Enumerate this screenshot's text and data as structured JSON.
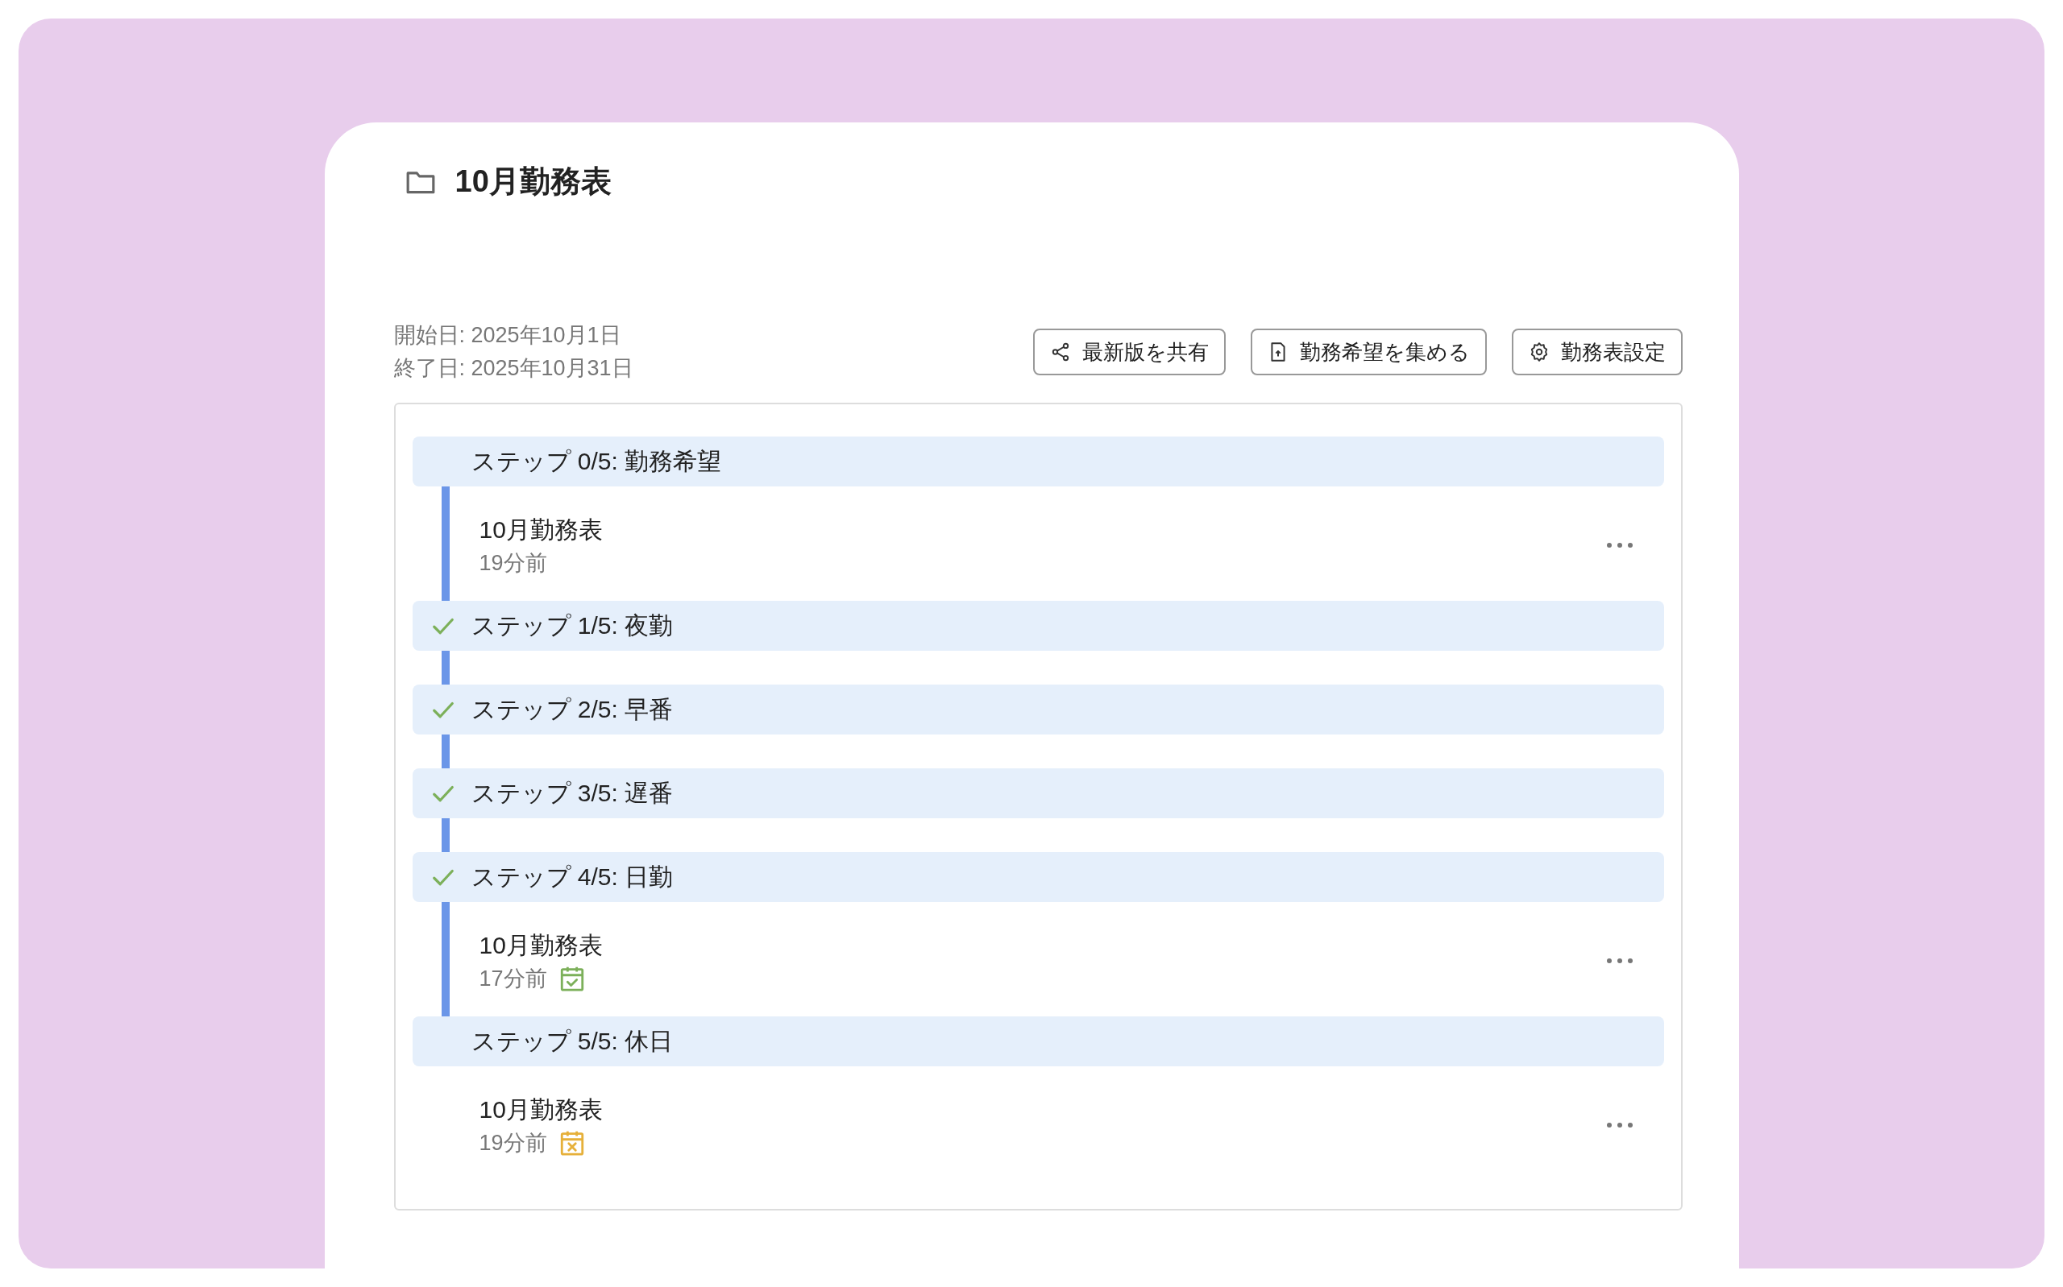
{
  "title": "10月勤務表",
  "start_date": "開始日: 2025年10月1日",
  "end_date": "終了日: 2025年10月31日",
  "buttons": [
    {
      "kind": "share",
      "label": "最新版を共有"
    },
    {
      "kind": "collect",
      "label": "勤務希望を集める"
    },
    {
      "kind": "settings",
      "label": "勤務表設定"
    }
  ],
  "steps": [
    {
      "label": "ステップ 0/5: 勤務希望",
      "done": false,
      "rail": true,
      "items": [
        {
          "title": "10月勤務表",
          "time": "19分前"
        }
      ]
    },
    {
      "label": "ステップ 1/5: 夜勤",
      "done": true,
      "rail": true
    },
    {
      "label": "ステップ 2/5: 早番",
      "done": true,
      "rail": true
    },
    {
      "label": "ステップ 3/5: 遅番",
      "done": true,
      "rail": true
    },
    {
      "label": "ステップ 4/5: 日勤",
      "done": true,
      "rail": true,
      "items": [
        {
          "title": "10月勤務表",
          "time": "17分前",
          "kind": "approved"
        }
      ]
    },
    {
      "label": "ステップ 5/5: 休日",
      "done": false,
      "rail": false,
      "items": [
        {
          "title": "10月勤務表",
          "time": "19分前",
          "kind": "rejected"
        }
      ]
    }
  ]
}
